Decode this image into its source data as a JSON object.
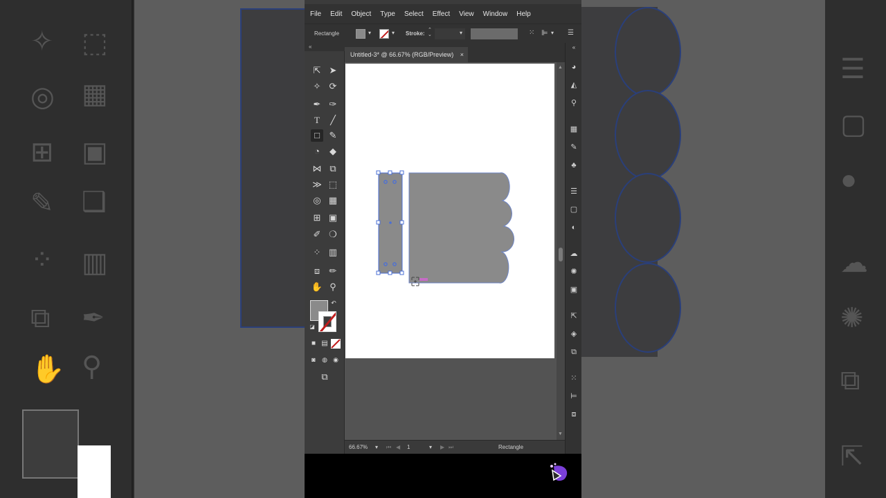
{
  "menu": [
    "File",
    "Edit",
    "Object",
    "Type",
    "Select",
    "Effect",
    "View",
    "Window",
    "Help"
  ],
  "control_bar": {
    "selection_type": "Rectangle",
    "stroke_label": "Stroke:",
    "fill_color": "#8a8a8a"
  },
  "document_tab": {
    "title": "Untitled-3* @ 66.67% (RGB/Preview)",
    "close": "×"
  },
  "status_bar": {
    "zoom": "66.67%",
    "artboard_number": "1",
    "selected_tool": "Rectangle"
  },
  "colors": {
    "ui_dark": "#323232",
    "ui_mid": "#535353",
    "shape_fill": "#8a8a8a",
    "selection_accent": "#4a6fd6",
    "stroke_none_red": "#c01c1c"
  },
  "icons": {
    "tools": [
      "selection-tool",
      "direct-selection-tool",
      "magic-wand-tool",
      "lasso-tool",
      "pen-tool",
      "curvature-tool",
      "type-tool",
      "line-tool",
      "rectangle-tool",
      "paintbrush-tool",
      "shaper-tool",
      "eraser-tool",
      "rotate-tool",
      "scale-tool",
      "width-tool",
      "free-transform-tool",
      "shape-builder-tool",
      "perspective-grid-tool",
      "mesh-tool",
      "gradient-tool",
      "eyedropper-tool",
      "blend-tool",
      "symbol-sprayer-tool",
      "column-graph-tool",
      "artboard-tool",
      "slice-tool",
      "hand-tool",
      "zoom-tool"
    ],
    "panels": [
      "color-panel",
      "color-guide-panel",
      "image-trace-panel",
      "swatches-panel",
      "brushes-panel",
      "symbols-panel",
      "stroke-panel",
      "gradient-panel",
      "transparency-panel",
      "libraries-panel",
      "appearance-panel",
      "graphic-styles-panel",
      "export-panel",
      "layers-panel",
      "artboards-panel",
      "align-panel",
      "transform-panel",
      "pathfinder-panel"
    ]
  }
}
